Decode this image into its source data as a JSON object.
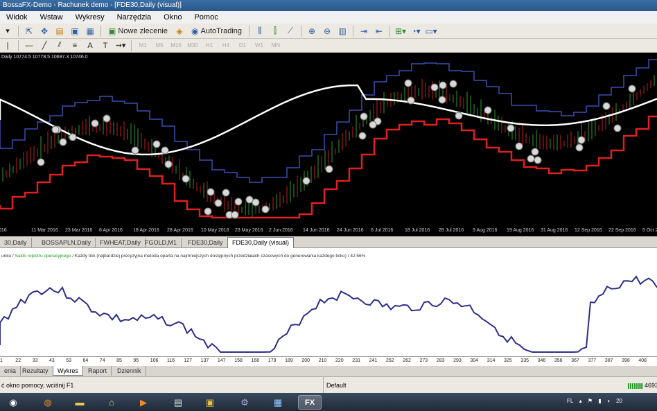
{
  "window": {
    "title": "BossaFX-Demo - Rachunek demo - [FDE30,Daily (visual)]"
  },
  "menu": [
    "Widok",
    "Wstaw",
    "Wykresy",
    "Narzędzia",
    "Okno",
    "Pomoc"
  ],
  "toolbar": {
    "new_order": "Nowe zlecenie",
    "autotrading": "AutoTrading"
  },
  "timeframes": [
    "M1",
    "M5",
    "M15",
    "M30",
    "H1",
    "H4",
    "D1",
    "W1",
    "MN"
  ],
  "chart": {
    "info": "Daily 10774.5 10778.5 10697.3 10746.0",
    "x_labels": [
      "016",
      "11 Mar 2016",
      "23 Mar 2016",
      "6 Apr 2016",
      "18 Apr 2016",
      "28 Apr 2016",
      "10 May 2016",
      "23 May 2016",
      "2 Jun 2016",
      "14 Jun 2016",
      "24 Jun 2016",
      "6 Jul 2016",
      "18 Jul 2016",
      "28 Jul 2016",
      "9 Aug 2016",
      "19 Aug 2016",
      "31 Aug 2016",
      "12 Sep 2016",
      "22 Sep 2016",
      "5 Oct 201"
    ],
    "colors": {
      "background": "#000000",
      "upper_band": "#3a4fb0",
      "lower_band": "#e02020",
      "moving_average": "#ffffff",
      "candle_up": "#2e9b2e",
      "candle_down": "#c02020"
    }
  },
  "chart_tabs": [
    "30,Daily",
    "BOSSAPLN,Daily",
    "FWHEAT,Daily",
    "FGOLD,M1",
    "FDE30,Daily",
    "FDE30,Daily (visual)"
  ],
  "equity": {
    "legend_prefix": "unku /",
    "legend_green": "Saldo rejestru operacyjnego",
    "legend_rest": "/ Każdy tick (najbardziej precyzyjna metoda oparta na najmniejszych dostępnych przedziałach czasowych do generowania każdego ticku) / 42.56%",
    "x_labels": [
      "1",
      "22",
      "33",
      "43",
      "53",
      "64",
      "74",
      "85",
      "95",
      "106",
      "116",
      "127",
      "137",
      "147",
      "158",
      "168",
      "179",
      "189",
      "200",
      "210",
      "220",
      "231",
      "241",
      "252",
      "262",
      "273",
      "283",
      "293",
      "304",
      "314",
      "325",
      "335",
      "346",
      "356",
      "367",
      "377",
      "387",
      "398",
      "408"
    ],
    "line_color": "#2b2e86"
  },
  "bottom_tabs": [
    "enia",
    "Rezultaty",
    "Wykres",
    "Raport",
    "Dziennik"
  ],
  "status": {
    "help": "ć okno pomocy, wciśnij F1",
    "profile": "Default",
    "traffic": "4693"
  },
  "tray": {
    "lang": "FL",
    "time": "20"
  }
}
